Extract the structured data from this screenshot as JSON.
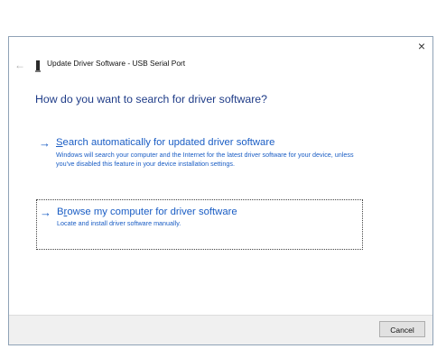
{
  "dialog": {
    "title": "Update Driver Software - USB Serial Port",
    "close_glyph": "×",
    "back_glyph": "←",
    "heading": "How do you want to search for driver software?"
  },
  "options": [
    {
      "arrow": "→",
      "mnemonic": "S",
      "title_rest": "earch automatically for updated driver software",
      "description": "Windows will search your computer and the Internet for the latest driver software for your device, unless you've disabled this feature in your device installation settings."
    },
    {
      "arrow": "→",
      "title_pre": "B",
      "mnemonic": "r",
      "title_rest": "owse my computer for driver software",
      "description": "Locate and install driver software manually."
    }
  ],
  "footer": {
    "cancel_label": "Cancel"
  },
  "icons": {
    "back": "back-arrow-icon",
    "close": "close-icon",
    "device": "usb-device-icon",
    "option_arrow": "arrow-right-icon"
  }
}
